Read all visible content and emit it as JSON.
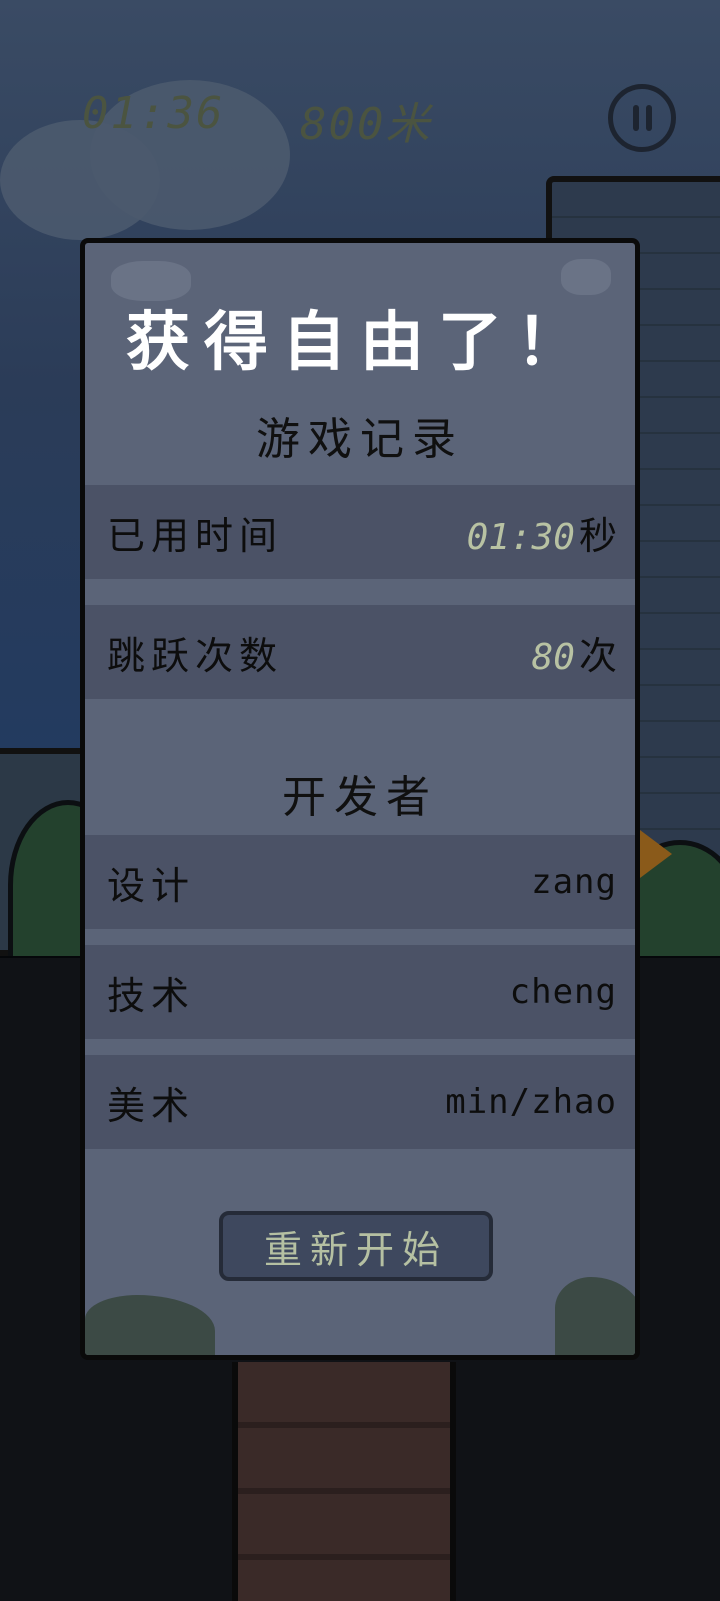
{
  "hud": {
    "time": "01:36",
    "distance": "800米"
  },
  "result": {
    "title": "获得自由了！",
    "record_heading": "游戏记录",
    "time_label": "已用时间",
    "time_value": "01:30",
    "time_unit": "秒",
    "jumps_label": "跳跃次数",
    "jumps_value": "80",
    "jumps_unit": "次",
    "dev_heading": "开发者",
    "developers": [
      {
        "role": "设计",
        "name": "zang"
      },
      {
        "role": "技术",
        "name": "cheng"
      },
      {
        "role": "美术",
        "name": "min/zhao"
      }
    ],
    "restart_label": "重新开始"
  },
  "colors": {
    "panel_bg": "#5b6478",
    "row_bg": "#4b5266",
    "number_accent": "#b8c2a3",
    "button_bg": "#3e485e"
  },
  "icons": {
    "pause": "pause-icon"
  }
}
